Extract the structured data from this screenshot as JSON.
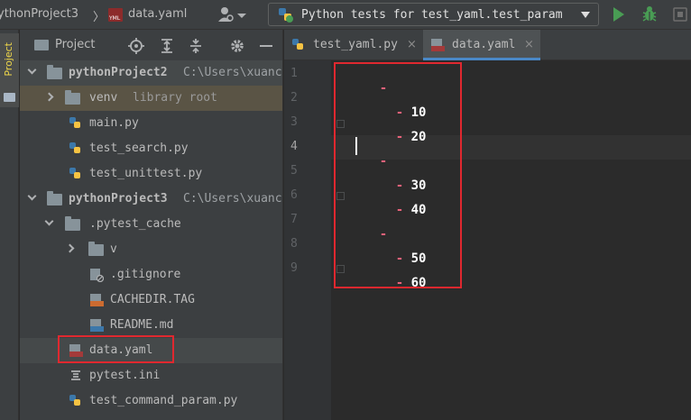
{
  "topbar": {
    "project_crumb": "ythonProject3",
    "crumb_separator": "〉",
    "file_crumb": "data.yaml",
    "run_config_label": "Python tests for test_yaml.test_param"
  },
  "project_panel": {
    "title": "Project",
    "tree": [
      {
        "name": "pythonProject2",
        "path": "C:\\Users\\xuanc",
        "kind": "folder",
        "expanded": true
      },
      {
        "name": "venv",
        "tag": "library root",
        "kind": "folder",
        "expanded": false
      },
      {
        "name": "main.py",
        "kind": "python"
      },
      {
        "name": "test_search.py",
        "kind": "python"
      },
      {
        "name": "test_unittest.py",
        "kind": "python"
      },
      {
        "name": "pythonProject3",
        "path": "C:\\Users\\xuanc",
        "kind": "folder",
        "expanded": true
      },
      {
        "name": ".pytest_cache",
        "kind": "folder",
        "expanded": true
      },
      {
        "name": "v",
        "kind": "folder",
        "expanded": false
      },
      {
        "name": ".gitignore",
        "kind": "gitignore"
      },
      {
        "name": "CACHEDIR.TAG",
        "kind": "jsp"
      },
      {
        "name": "README.md",
        "kind": "markdown"
      },
      {
        "name": "data.yaml",
        "kind": "yaml"
      },
      {
        "name": "pytest.ini",
        "kind": "ini"
      },
      {
        "name": "test_command_param.py",
        "kind": "python"
      }
    ]
  },
  "editor": {
    "tabs": [
      {
        "label": "test_yaml.py",
        "close": "×",
        "active": false
      },
      {
        "label": "data.yaml",
        "close": "×",
        "active": true
      }
    ],
    "line_numbers": [
      "1",
      "2",
      "3",
      "4",
      "5",
      "6",
      "7",
      "8",
      "9"
    ],
    "current_line": 4,
    "lines": [
      {
        "dash": "-",
        "value": ""
      },
      {
        "dash": "- ",
        "value": "10"
      },
      {
        "dash": "- ",
        "value": "20"
      },
      {
        "dash": "-",
        "value": ""
      },
      {
        "dash": "- ",
        "value": "30"
      },
      {
        "dash": "- ",
        "value": "40"
      },
      {
        "dash": "-",
        "value": ""
      },
      {
        "dash": "- ",
        "value": "50"
      },
      {
        "dash": "- ",
        "value": "60"
      }
    ]
  },
  "icons": {
    "yaml_file": "yaml-file-icon",
    "python_file": "python-file-icon",
    "folder": "folder-icon",
    "run": "run-icon",
    "debug": "debug-bug-icon",
    "stop": "stop-icon"
  },
  "colors": {
    "background": "#2b2b2b",
    "panel": "#3c3f41",
    "highlight_box": "#e0282f",
    "yaml_dash": "#e8627a",
    "run_green": "#499c54"
  }
}
